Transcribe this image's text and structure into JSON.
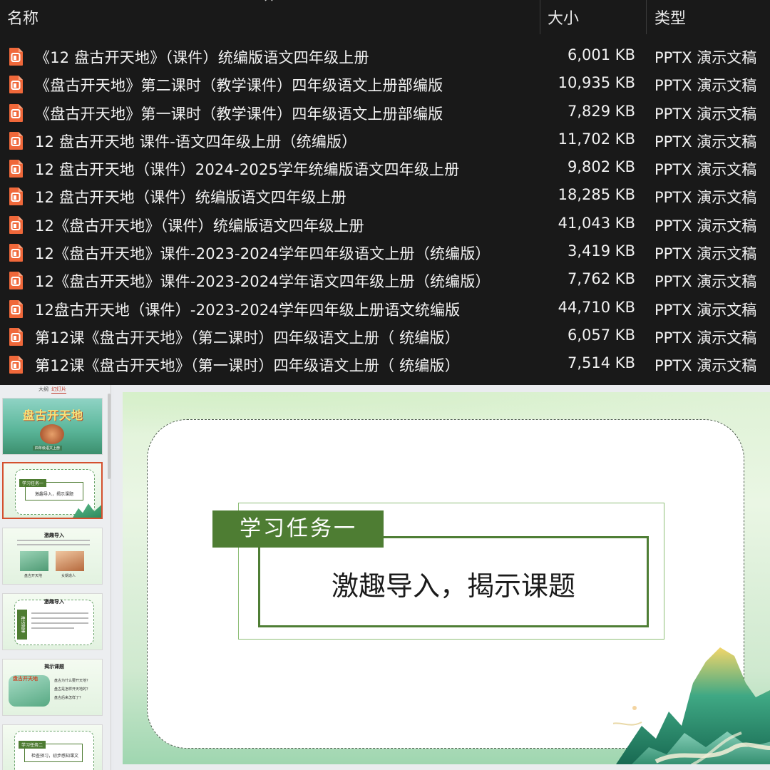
{
  "explorer": {
    "columns": {
      "name": "名称",
      "size": "大小",
      "type": "类型"
    },
    "files": [
      {
        "name": "《12 盘古开天地》（课件）统编版语文四年级上册",
        "size": "6,001 KB",
        "type": "PPTX 演示文稿"
      },
      {
        "name": "《盘古开天地》第二课时（教学课件）四年级语文上册部编版",
        "size": "10,935 KB",
        "type": "PPTX 演示文稿"
      },
      {
        "name": "《盘古开天地》第一课时（教学课件）四年级语文上册部编版",
        "size": "7,829 KB",
        "type": "PPTX 演示文稿"
      },
      {
        "name": "12 盘古开天地 课件-语文四年级上册（统编版）",
        "size": "11,702 KB",
        "type": "PPTX 演示文稿"
      },
      {
        "name": "12 盘古开天地（课件）2024-2025学年统编版语文四年级上册",
        "size": "9,802 KB",
        "type": "PPTX 演示文稿"
      },
      {
        "name": "12 盘古开天地（课件）统编版语文四年级上册",
        "size": "18,285 KB",
        "type": "PPTX 演示文稿"
      },
      {
        "name": "12《盘古开天地》（课件）统编版语文四年级上册",
        "size": "41,043 KB",
        "type": "PPTX 演示文稿"
      },
      {
        "name": "12《盘古开天地》课件-2023-2024学年四年级语文上册（统编版）",
        "size": "3,419 KB",
        "type": "PPTX 演示文稿"
      },
      {
        "name": "12《盘古开天地》课件-2023-2024学年语文四年级上册（统编版）",
        "size": "7,762 KB",
        "type": "PPTX 演示文稿"
      },
      {
        "name": "12盘古开天地（课件）-2023-2024学年四年级上册语文统编版",
        "size": "44,710 KB",
        "type": "PPTX 演示文稿"
      },
      {
        "name": "第12课《盘古开天地》（第二课时）四年级语文上册（ 统编版）",
        "size": "6,057 KB",
        "type": "PPTX 演示文稿"
      },
      {
        "name": "第12课《盘古开天地》（第一课时）四年级语文上册（ 统编版）",
        "size": "7,514 KB",
        "type": "PPTX 演示文稿"
      }
    ]
  },
  "editor": {
    "tabs": {
      "outline": "大纲",
      "slides": "幻灯片"
    },
    "thumbnails": {
      "t1": {
        "title": "盘古开天地",
        "sub": "四年级语文上册"
      },
      "t2": {
        "label": "学习任务一",
        "text": "激趣导入，揭示课题"
      },
      "t3": {
        "title": "激趣导入",
        "caption_left": "盘古开天地",
        "caption_right": "女娲造人"
      },
      "t4": {
        "title": "激趣导入",
        "side": "神话故事"
      },
      "t5": {
        "title": "揭示课题",
        "side": "盘古开天地",
        "bullets": [
          "盘古为什么要开天地？",
          "盘古是怎样开天地的？",
          "盘古后来怎样了？"
        ]
      },
      "t6": {
        "label": "学习任务二",
        "text": "检查预习，初步感知课文"
      }
    },
    "slide": {
      "task_label": "学习任务一",
      "subtitle": "激趣导入，揭示课题"
    }
  },
  "colors": {
    "accent_green": "#4e7d33",
    "file_icon": "#f0683a",
    "selection": "#d4502e"
  }
}
